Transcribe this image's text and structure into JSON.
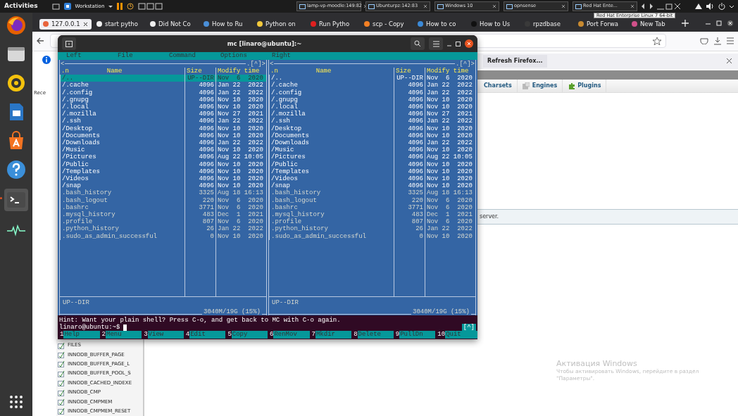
{
  "top_bar": {
    "activities": "Activities",
    "vm_menu": "Workstation",
    "vm_tabs": [
      {
        "label": "lamp-vp-moodle:149:82"
      },
      {
        "label": "Ubunturpz:142:83"
      },
      {
        "label": "Windows 10"
      },
      {
        "label": "opnsense"
      },
      {
        "label": "Red Hat Ente..."
      }
    ],
    "tooltip": "Red Hat Enterprise Linux 7 64-bit"
  },
  "dock": [
    {
      "kind": "firefox",
      "running": false
    },
    {
      "kind": "files",
      "running": false
    },
    {
      "kind": "music",
      "running": false
    },
    {
      "kind": "writer",
      "running": false
    },
    {
      "kind": "software",
      "running": false
    },
    {
      "kind": "help",
      "running": false
    },
    {
      "kind": "terminal",
      "running": true
    },
    {
      "kind": "monitor",
      "running": false
    },
    {
      "kind": "apps",
      "running": false
    }
  ],
  "browser": {
    "tabs": [
      {
        "label": "127.0.0.1",
        "selected": true,
        "color": "#e8643c"
      },
      {
        "label": "start pytho",
        "selected": false,
        "color": "#f0f0f0"
      },
      {
        "label": "Did Not Co",
        "selected": false,
        "color": "#f0f0f0"
      },
      {
        "label": "How to Ru",
        "selected": false,
        "color": "#4a8fd8"
      },
      {
        "label": "Python on",
        "selected": false,
        "color": "#f3c93c"
      },
      {
        "label": "Run Pytho",
        "selected": false,
        "color": "#e02020"
      },
      {
        "label": "scp - Copy",
        "selected": false,
        "color": "#f48024"
      },
      {
        "label": "How to co",
        "selected": false,
        "color": "#3b8ad8"
      },
      {
        "label": "How to Us",
        "selected": false,
        "color": "#111111"
      },
      {
        "label": "rpzdbase",
        "selected": false,
        "color": "#3a3a3a"
      },
      {
        "label": "Port Forwa",
        "selected": false,
        "color": "#c88a30"
      },
      {
        "label": "New Tab",
        "selected": false,
        "color": "#d0508a"
      }
    ],
    "left_fragment": "Rece",
    "notification_button": "Refresh Firefox...",
    "section_tabs": [
      {
        "label": "Charsets",
        "kind": "plain"
      },
      {
        "label": "Engines",
        "kind": "engine"
      },
      {
        "label": "Plugins",
        "kind": "plugin"
      }
    ],
    "message": "server.",
    "tree_items": [
      "FILES",
      "INNODB_BUFFER_PAGE",
      "INNODB_BUFFER_PAGE_L",
      "INNODB_BUFFER_POOL_S",
      "INNODB_CACHED_INDEXE",
      "INNODB_CMP",
      "INNODB_CMPMEM",
      "INNODB_CMPMEM_RESET"
    ],
    "watermark_title": "Активация Windows",
    "watermark_body": "Чтобы активировать Windows, перейдите в раздел \"Параметры\"."
  },
  "terminal": {
    "title": "mc [linaro@ubuntu]:~",
    "menu": [
      "Left",
      "File",
      "Command",
      "Options",
      "Right"
    ],
    "panels": [
      {
        "corner_left": "<",
        "corner_right": ".[^]>",
        "columns": [
          ".n",
          "Name",
          "Size",
          "Modify time"
        ],
        "status": "UP--DIR",
        "disk": "3040M/19G (15%)",
        "rows": [
          {
            "name": "/..",
            "size": "UP--DIR",
            "time": "Nov  6  2020",
            "kind": "dir",
            "selected": true
          },
          {
            "name": "/.cache",
            "size": "4096",
            "time": "Jan 22  2022",
            "kind": "dir",
            "selected": false
          },
          {
            "name": "/.config",
            "size": "4096",
            "time": "Jan 22  2022",
            "kind": "dir",
            "selected": false
          },
          {
            "name": "/.gnupg",
            "size": "4096",
            "time": "Nov 10  2020",
            "kind": "dir",
            "selected": false
          },
          {
            "name": "/.local",
            "size": "4096",
            "time": "Nov 10  2020",
            "kind": "dir",
            "selected": false
          },
          {
            "name": "/.mozilla",
            "size": "4096",
            "time": "Nov 27  2021",
            "kind": "dir",
            "selected": false
          },
          {
            "name": "/.ssh",
            "size": "4096",
            "time": "Jan 22  2022",
            "kind": "dir",
            "selected": false
          },
          {
            "name": "/Desktop",
            "size": "4096",
            "time": "Nov 10  2020",
            "kind": "dir",
            "selected": false
          },
          {
            "name": "/Documents",
            "size": "4096",
            "time": "Nov 10  2020",
            "kind": "dir",
            "selected": false
          },
          {
            "name": "/Downloads",
            "size": "4096",
            "time": "Jan 22  2022",
            "kind": "dir",
            "selected": false
          },
          {
            "name": "/Music",
            "size": "4096",
            "time": "Nov 10  2020",
            "kind": "dir",
            "selected": false
          },
          {
            "name": "/Pictures",
            "size": "4096",
            "time": "Aug 22 10:05",
            "kind": "dir",
            "selected": false
          },
          {
            "name": "/Public",
            "size": "4096",
            "time": "Nov 10  2020",
            "kind": "dir",
            "selected": false
          },
          {
            "name": "/Templates",
            "size": "4096",
            "time": "Nov 10  2020",
            "kind": "dir",
            "selected": false
          },
          {
            "name": "/Videos",
            "size": "4096",
            "time": "Nov 10  2020",
            "kind": "dir",
            "selected": false
          },
          {
            "name": "/snap",
            "size": "4096",
            "time": "Nov 10  2020",
            "kind": "dir",
            "selected": false
          },
          {
            "name": ".bash_history",
            "size": "3325",
            "time": "Aug 18 16:13",
            "kind": "file",
            "selected": false
          },
          {
            "name": ".bash_logout",
            "size": "220",
            "time": "Nov  6  2020",
            "kind": "file",
            "selected": false
          },
          {
            "name": ".bashrc",
            "size": "3771",
            "time": "Nov  6  2020",
            "kind": "file",
            "selected": false
          },
          {
            "name": ".mysql_history",
            "size": "483",
            "time": "Dec  1  2021",
            "kind": "file",
            "selected": false
          },
          {
            "name": ".profile",
            "size": "807",
            "time": "Nov  6  2020",
            "kind": "file",
            "selected": false
          },
          {
            "name": ".python_history",
            "size": "26",
            "time": "Jan 22  2022",
            "kind": "file",
            "selected": false
          },
          {
            "name": ".sudo_as_admin_successful",
            "size": "0",
            "time": "Nov 10  2020",
            "kind": "file",
            "selected": false
          }
        ]
      },
      {
        "corner_left": "<",
        "corner_right": ".[^]>",
        "columns": [
          ".n",
          "Name",
          "Size",
          "Modify time"
        ],
        "status": "UP--DIR",
        "disk": "3040M/19G (15%)",
        "rows": [
          {
            "name": "/..",
            "size": "UP--DIR",
            "time": "Nov  6  2020",
            "kind": "dir",
            "selected": false
          },
          {
            "name": "/.cache",
            "size": "4096",
            "time": "Jan 22  2022",
            "kind": "dir",
            "selected": false
          },
          {
            "name": "/.config",
            "size": "4096",
            "time": "Jan 22  2022",
            "kind": "dir",
            "selected": false
          },
          {
            "name": "/.gnupg",
            "size": "4096",
            "time": "Nov 10  2020",
            "kind": "dir",
            "selected": false
          },
          {
            "name": "/.local",
            "size": "4096",
            "time": "Nov 10  2020",
            "kind": "dir",
            "selected": false
          },
          {
            "name": "/.mozilla",
            "size": "4096",
            "time": "Nov 27  2021",
            "kind": "dir",
            "selected": false
          },
          {
            "name": "/.ssh",
            "size": "4096",
            "time": "Jan 22  2022",
            "kind": "dir",
            "selected": false
          },
          {
            "name": "/Desktop",
            "size": "4096",
            "time": "Nov 10  2020",
            "kind": "dir",
            "selected": false
          },
          {
            "name": "/Documents",
            "size": "4096",
            "time": "Nov 10  2020",
            "kind": "dir",
            "selected": false
          },
          {
            "name": "/Downloads",
            "size": "4096",
            "time": "Jan 22  2022",
            "kind": "dir",
            "selected": false
          },
          {
            "name": "/Music",
            "size": "4096",
            "time": "Nov 10  2020",
            "kind": "dir",
            "selected": false
          },
          {
            "name": "/Pictures",
            "size": "4096",
            "time": "Aug 22 10:05",
            "kind": "dir",
            "selected": false
          },
          {
            "name": "/Public",
            "size": "4096",
            "time": "Nov 10  2020",
            "kind": "dir",
            "selected": false
          },
          {
            "name": "/Templates",
            "size": "4096",
            "time": "Nov 10  2020",
            "kind": "dir",
            "selected": false
          },
          {
            "name": "/Videos",
            "size": "4096",
            "time": "Nov 10  2020",
            "kind": "dir",
            "selected": false
          },
          {
            "name": "/snap",
            "size": "4096",
            "time": "Nov 10  2020",
            "kind": "dir",
            "selected": false
          },
          {
            "name": ".bash_history",
            "size": "3325",
            "time": "Aug 18 16:13",
            "kind": "file",
            "selected": false
          },
          {
            "name": ".bash_logout",
            "size": "220",
            "time": "Nov  6  2020",
            "kind": "file",
            "selected": false
          },
          {
            "name": ".bashrc",
            "size": "3771",
            "time": "Nov  6  2020",
            "kind": "file",
            "selected": false
          },
          {
            "name": ".mysql_history",
            "size": "483",
            "time": "Dec  1  2021",
            "kind": "file",
            "selected": false
          },
          {
            "name": ".profile",
            "size": "807",
            "time": "Nov  6  2020",
            "kind": "file",
            "selected": false
          },
          {
            "name": ".python_history",
            "size": "26",
            "time": "Jan 22  2022",
            "kind": "file",
            "selected": false
          },
          {
            "name": ".sudo_as_admin_successful",
            "size": "0",
            "time": "Nov 10  2020",
            "kind": "file",
            "selected": false
          }
        ]
      }
    ],
    "hint": "Hint: Want your plain shell? Press C-o, and get back to MC with C-o again.",
    "prompt": "linaro@ubuntu:~$",
    "scroll_marker": "[^]",
    "function_keys": [
      {
        "number": "1",
        "label": "Help"
      },
      {
        "number": "2",
        "label": "Menu"
      },
      {
        "number": "3",
        "label": "View"
      },
      {
        "number": "4",
        "label": "Edit"
      },
      {
        "number": "5",
        "label": "Copy"
      },
      {
        "number": "6",
        "label": "RenMov"
      },
      {
        "number": "7",
        "label": "Mkdir"
      },
      {
        "number": "8",
        "label": "Delete"
      },
      {
        "number": "9",
        "label": "PullDn"
      },
      {
        "number": "10",
        "label": "Quit"
      }
    ]
  }
}
